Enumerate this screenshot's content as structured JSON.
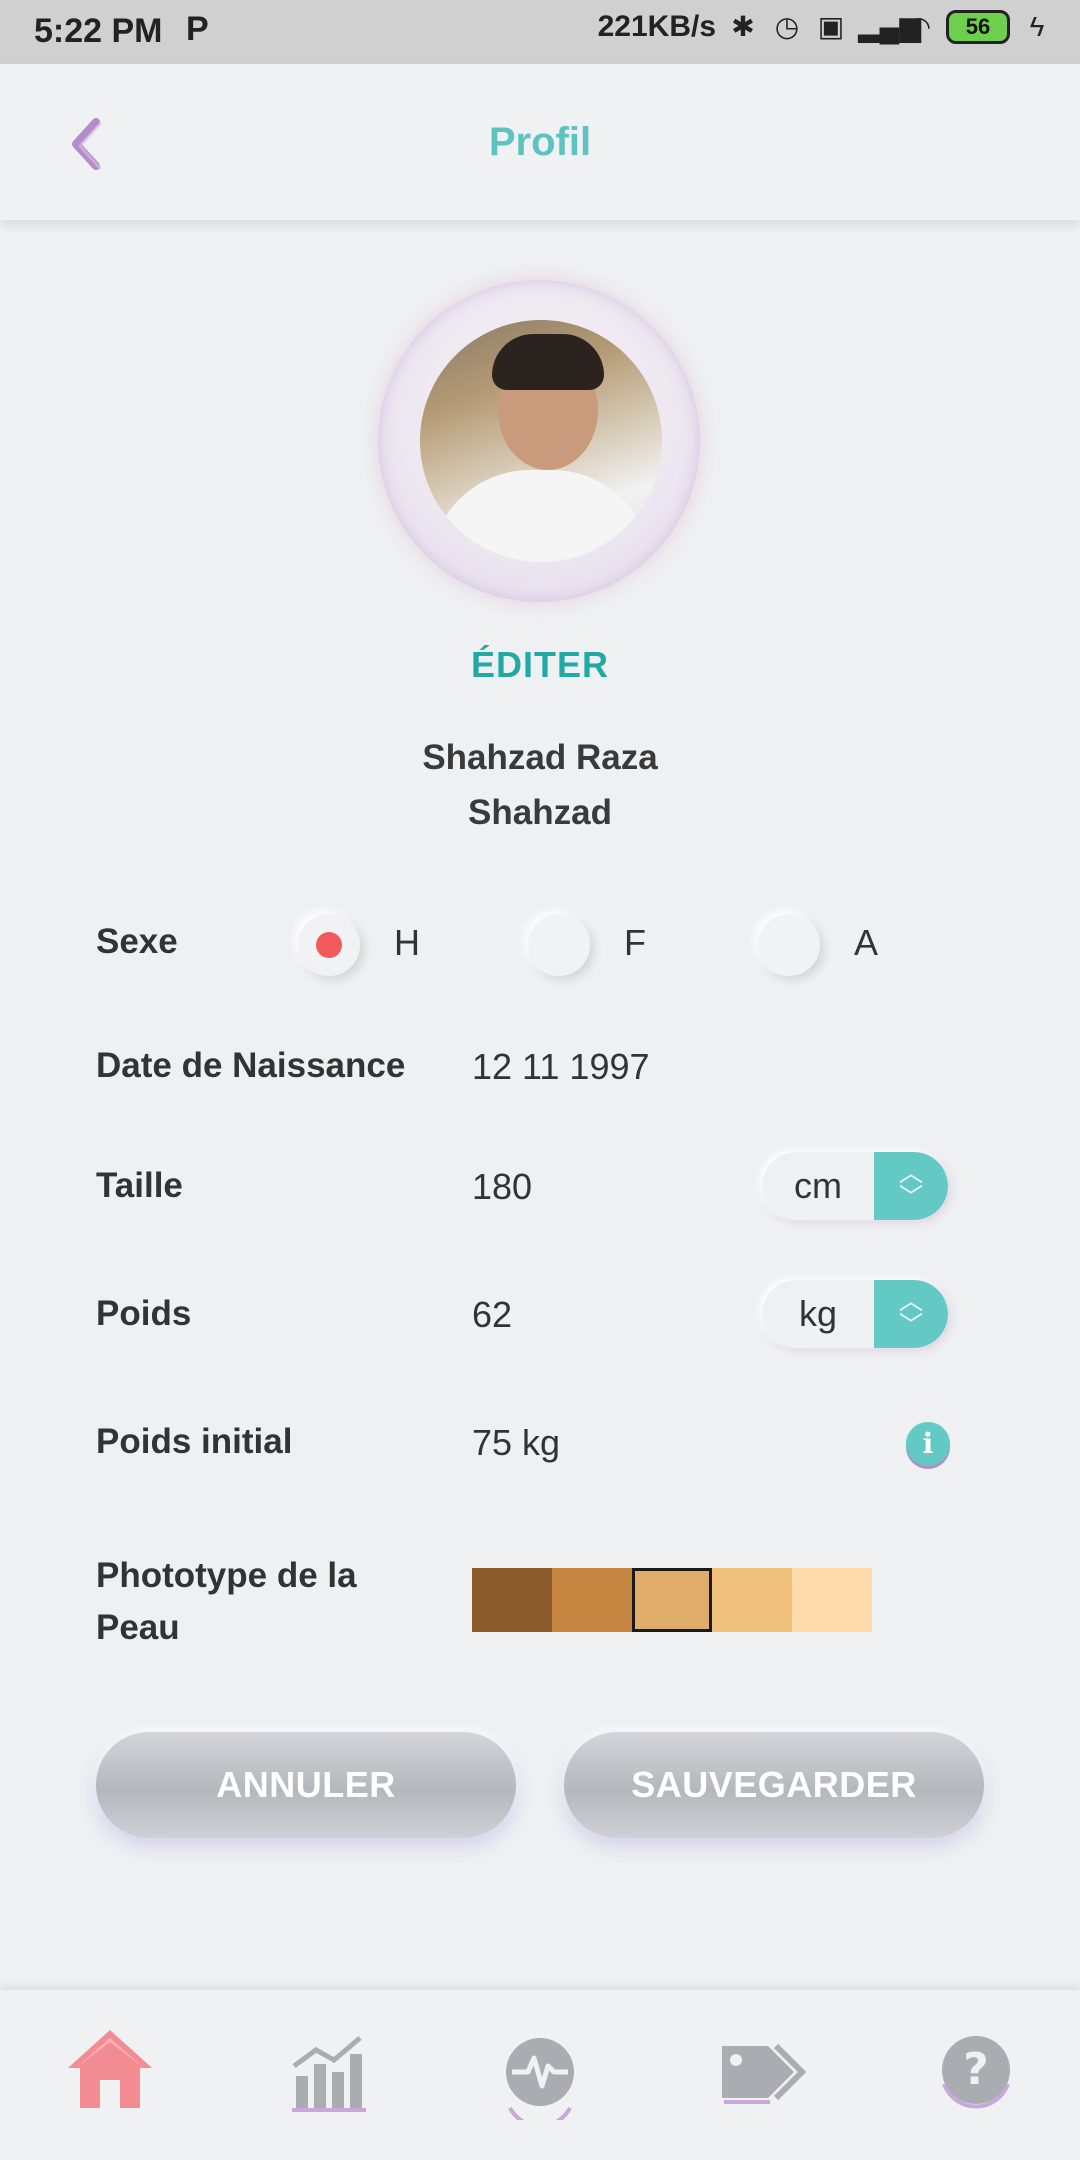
{
  "status_bar": {
    "time": "5:22 PM",
    "app_indicator": "P",
    "network_speed": "221KB/s",
    "battery_level": "56"
  },
  "header": {
    "title": "Profil"
  },
  "profile": {
    "edit_label": "ÉDITER",
    "name": "Shahzad Raza",
    "username": "Shahzad"
  },
  "form": {
    "sex": {
      "label": "Sexe",
      "options": [
        "H",
        "F",
        "A"
      ],
      "selected": "H"
    },
    "birth_date": {
      "label": "Date de Naissance",
      "value": "12 11 1997"
    },
    "height": {
      "label": "Taille",
      "value": "180",
      "unit": "cm"
    },
    "weight": {
      "label": "Poids",
      "value": "62",
      "unit": "kg"
    },
    "initial_weight": {
      "label": "Poids initial",
      "value": "75 kg"
    },
    "skin_phototype": {
      "label_line1": "Phototype de la",
      "label_line2": "Peau",
      "swatches": [
        "#8b5a2b",
        "#c68642",
        "#e0ac69",
        "#f1c27d",
        "#ffdbac"
      ],
      "selected_index": 2
    }
  },
  "actions": {
    "cancel_label": "ANNULER",
    "save_label": "SAUVEGARDER"
  },
  "bottom_nav": {
    "items": [
      {
        "icon": "home-icon",
        "active": true
      },
      {
        "icon": "chart-icon",
        "active": false
      },
      {
        "icon": "heartbeat-icon",
        "active": false
      },
      {
        "icon": "tags-icon",
        "active": false
      },
      {
        "icon": "help-icon",
        "active": false
      }
    ]
  },
  "colors": {
    "accent": "#5ec3c0",
    "active_nav": "#f38b93",
    "radio_selected": "#f2595a"
  }
}
